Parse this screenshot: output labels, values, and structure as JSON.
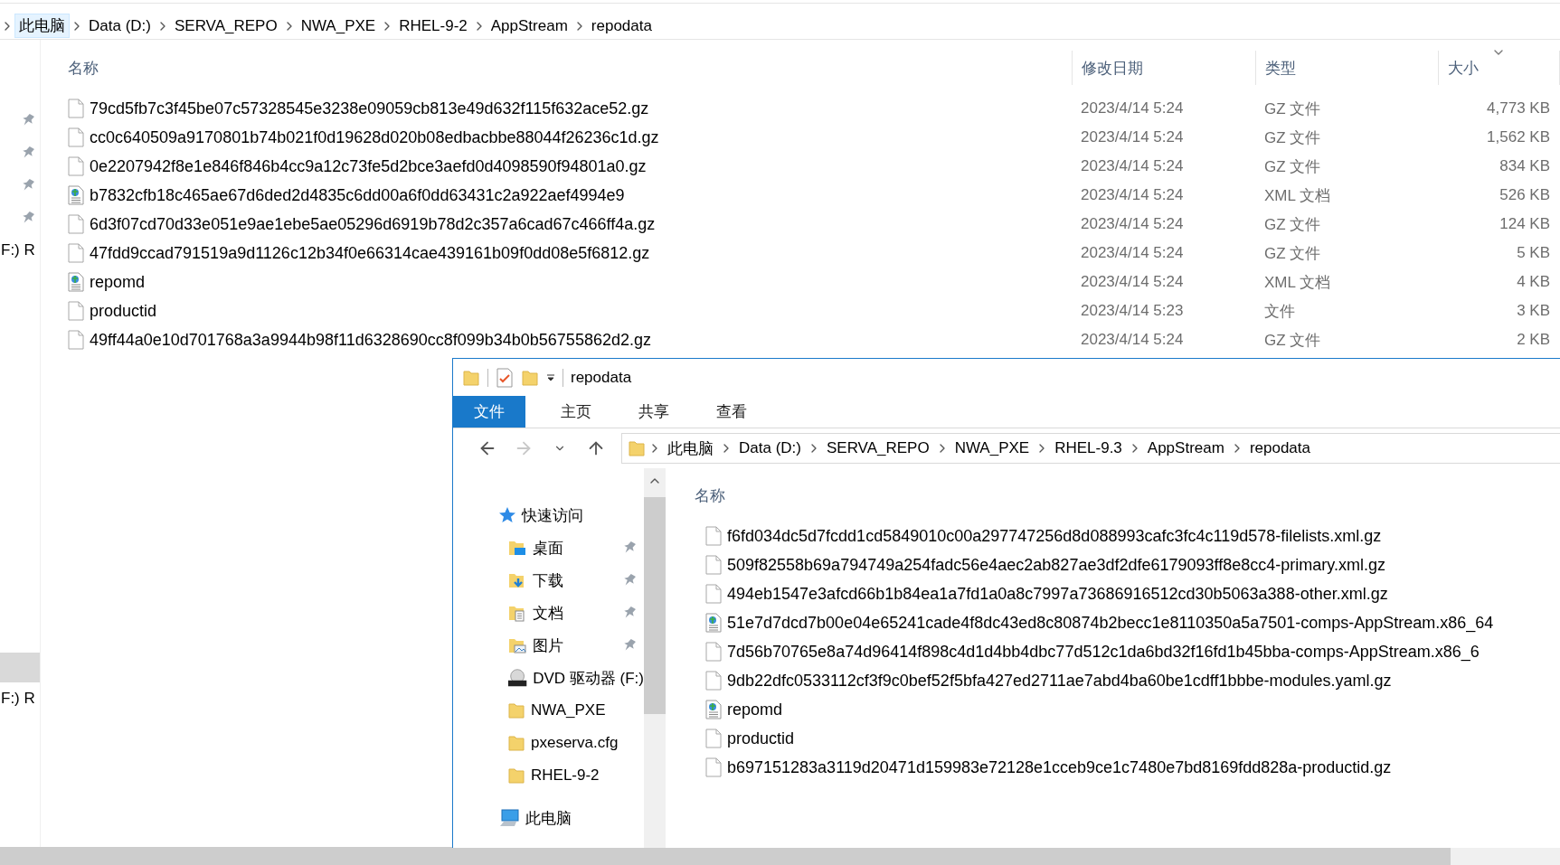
{
  "back_window": {
    "breadcrumb": [
      {
        "label": "此电脑",
        "hovered": true
      },
      {
        "label": "Data (D:)",
        "hovered": false
      },
      {
        "label": "SERVA_REPO",
        "hovered": false
      },
      {
        "label": "NWA_PXE",
        "hovered": false
      },
      {
        "label": "RHEL-9-2",
        "hovered": false
      },
      {
        "label": "AppStream",
        "hovered": false
      },
      {
        "label": "repodata",
        "hovered": false
      }
    ],
    "nav_top": [
      {
        "pinned": true,
        "selected": false
      },
      {
        "pinned": true,
        "selected": false
      },
      {
        "pinned": true,
        "selected": false
      },
      {
        "pinned": true,
        "selected": false
      },
      {
        "label": "F:) R",
        "selected": false
      }
    ],
    "nav_bottom": [
      {
        "selected": true
      },
      {
        "label": "F:) R",
        "selected": false
      }
    ],
    "columns": [
      {
        "label": "名称",
        "sorted": false
      },
      {
        "label": "修改日期",
        "sorted": false
      },
      {
        "label": "类型",
        "sorted": false
      },
      {
        "label": "大小",
        "sorted": true
      }
    ],
    "files": [
      {
        "kind": "file",
        "name": "79cd5fb7c3f45be07c57328545e3238e09059cb813e49d632f115f632ace52.gz",
        "modified": "2023/4/14 5:24",
        "type": "GZ 文件",
        "size": "4,773 KB"
      },
      {
        "kind": "file",
        "name": "cc0c640509a9170801b74b021f0d19628d020b08edbacbbe88044f26236c1d.gz",
        "modified": "2023/4/14 5:24",
        "type": "GZ 文件",
        "size": "1,562 KB"
      },
      {
        "kind": "file",
        "name": "0e2207942f8e1e846f846b4cc9a12c73fe5d2bce3aefd0d4098590f94801a0.gz",
        "modified": "2023/4/14 5:24",
        "type": "GZ 文件",
        "size": "834 KB"
      },
      {
        "kind": "xml",
        "name": "b7832cfb18c465ae67d6ded2d4835c6dd00a6f0dd63431c2a922aef4994e9",
        "modified": "2023/4/14 5:24",
        "type": "XML 文档",
        "size": "526 KB"
      },
      {
        "kind": "file",
        "name": "6d3f07cd70d33e051e9ae1ebe5ae05296d6919b78d2c357a6cad67c466ff4a.gz",
        "modified": "2023/4/14 5:24",
        "type": "GZ 文件",
        "size": "124 KB"
      },
      {
        "kind": "file",
        "name": "47fdd9ccad791519a9d1126c12b34f0e66314cae439161b09f0dd08e5f6812.gz",
        "modified": "2023/4/14 5:24",
        "type": "GZ 文件",
        "size": "5 KB"
      },
      {
        "kind": "xml",
        "name": "repomd",
        "modified": "2023/4/14 5:24",
        "type": "XML 文档",
        "size": "4 KB"
      },
      {
        "kind": "file",
        "name": "productid",
        "modified": "2023/4/14 5:23",
        "type": "文件",
        "size": "3 KB"
      },
      {
        "kind": "file",
        "name": "49ff44a0e10d701768a3a9944b98f11d6328690cc8f099b34b0b56755862d2.gz",
        "modified": "2023/4/14 5:24",
        "type": "GZ 文件",
        "size": "2 KB"
      }
    ]
  },
  "front_window": {
    "title": "repodata",
    "ribbon_tabs": [
      {
        "label": "文件",
        "kind": "file-menu"
      },
      {
        "label": "主页",
        "kind": "tab"
      },
      {
        "label": "共享",
        "kind": "tab"
      },
      {
        "label": "查看",
        "kind": "tab"
      }
    ],
    "breadcrumb": [
      "此电脑",
      "Data (D:)",
      "SERVA_REPO",
      "NWA_PXE",
      "RHEL-9.3",
      "AppStream",
      "repodata"
    ],
    "nav_items": [
      {
        "label": "快速访问",
        "kind": "star",
        "pinned": false,
        "children": [
          {
            "label": "桌面",
            "kind": "desktop",
            "pinned": true
          },
          {
            "label": "下载",
            "kind": "download",
            "pinned": true
          },
          {
            "label": "文档",
            "kind": "document",
            "pinned": true
          },
          {
            "label": "图片",
            "kind": "pictures",
            "pinned": true
          },
          {
            "label": "DVD 驱动器 (F:)",
            "kind": "dvd",
            "pinned": false
          },
          {
            "label": "NWA_PXE",
            "kind": "folder",
            "pinned": false
          },
          {
            "label": "pxeserva.cfg",
            "kind": "folder",
            "pinned": false
          },
          {
            "label": "RHEL-9-2",
            "kind": "folder",
            "pinned": false
          }
        ]
      },
      {
        "label": "此电脑",
        "kind": "pc",
        "pinned": false
      }
    ],
    "columns": [
      "名称"
    ],
    "files": [
      {
        "kind": "file",
        "name": "f6fd034dc5d7fcdd1cd5849010c00a297747256d8d088993cafc3fc4c119d578-filelists.xml.gz"
      },
      {
        "kind": "file",
        "name": "509f82558b69a794749a254fadc56e4aec2ab827ae3df2dfe6179093ff8e8cc4-primary.xml.gz"
      },
      {
        "kind": "file",
        "name": "494eb1547e3afcd66b1b84ea1a7fd1a0a8c7997a73686916512cd30b5063a388-other.xml.gz"
      },
      {
        "kind": "xml",
        "name": "51e7d7dcd7b00e04e65241cade4f8dc43ed8c80874b2becc1e8110350a5a7501-comps-AppStream.x86_64"
      },
      {
        "kind": "file",
        "name": "7d56b70765e8a74d96414f898c4d1d4bb4dbc77d512c1da6bd32f16fd1b45bba-comps-AppStream.x86_6"
      },
      {
        "kind": "file",
        "name": "9db22dfc0533112cf3f9c0bef52f5bfa427ed2711ae7abd4ba60be1cdff1bbbe-modules.yaml.gz"
      },
      {
        "kind": "xml",
        "name": "repomd"
      },
      {
        "kind": "file",
        "name": "productid"
      },
      {
        "kind": "file",
        "name": "b697151283a3119d20471d159983e72128e1cceb9ce1c7480e7bd8169fdd828a-productid.gz"
      }
    ]
  }
}
